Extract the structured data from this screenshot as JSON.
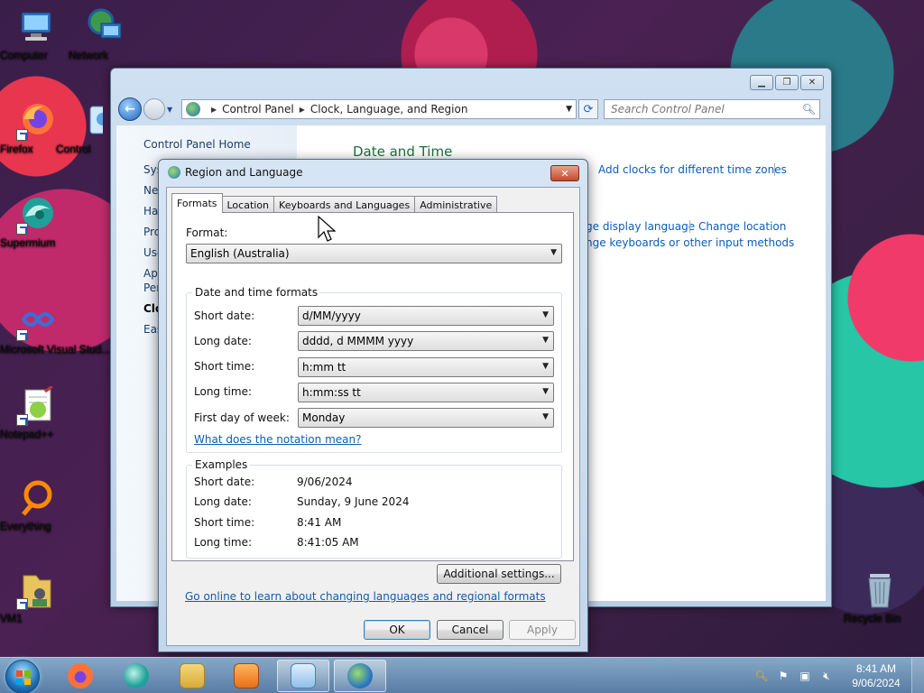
{
  "desktop": {
    "icons": [
      {
        "label": "Computer"
      },
      {
        "label": "Network"
      },
      {
        "label": "Firefox"
      },
      {
        "label": "Control"
      },
      {
        "label": "Supermium"
      },
      {
        "label": "Microsoft Visual Stud..."
      },
      {
        "label": "Notepad++"
      },
      {
        "label": "Everything"
      },
      {
        "label": "VM1"
      },
      {
        "label": "Recycle Bin"
      }
    ]
  },
  "control_panel": {
    "address": {
      "crumb1": "Control Panel",
      "crumb2": "Clock, Language, and Region"
    },
    "search_placeholder": "Search Control Panel",
    "left_nav": {
      "home": "Control Panel Home",
      "items": [
        "Sys",
        "Ne",
        "Ha",
        "Pro",
        "Use",
        "Ap",
        "Per",
        "Clo",
        "Eas"
      ]
    },
    "section_title": "Date and Time",
    "links": {
      "add_clocks": "Add clocks for different time zones",
      "change_display_language": "ge display language",
      "change_location": "Change location",
      "change_keyboards": "nge keyboards or other input methods"
    }
  },
  "dialog": {
    "title": "Region and Language",
    "close_glyph": "✕",
    "tabs": [
      "Formats",
      "Location",
      "Keyboards and Languages",
      "Administrative"
    ],
    "format_label": "Format:",
    "format_value": "English (Australia)",
    "date_time_group": "Date and time formats",
    "rows": [
      {
        "label": "Short date:",
        "value": "d/MM/yyyy"
      },
      {
        "label": "Long date:",
        "value": "dddd, d MMMM yyyy"
      },
      {
        "label": "Short time:",
        "value": "h:mm tt"
      },
      {
        "label": "Long time:",
        "value": "h:mm:ss tt"
      },
      {
        "label": "First day of week:",
        "value": "Monday"
      }
    ],
    "notation_link": "What does the notation mean?",
    "examples_group": "Examples",
    "examples": [
      {
        "label": "Short date:",
        "value": "9/06/2024"
      },
      {
        "label": "Long date:",
        "value": "Sunday, 9 June 2024"
      },
      {
        "label": "Short time:",
        "value": "8:41 AM"
      },
      {
        "label": "Long time:",
        "value": "8:41:05 AM"
      }
    ],
    "additional_settings": "Additional settings...",
    "online_link": "Go online to learn about changing languages and regional formats",
    "ok": "OK",
    "cancel": "Cancel",
    "apply": "Apply"
  },
  "taskbar": {
    "time": "8:41 AM",
    "date": "9/06/2024"
  },
  "colors": {
    "link": "#0f5cb0",
    "section_title": "#1e6e3c",
    "close_button": "#c54a2e"
  }
}
